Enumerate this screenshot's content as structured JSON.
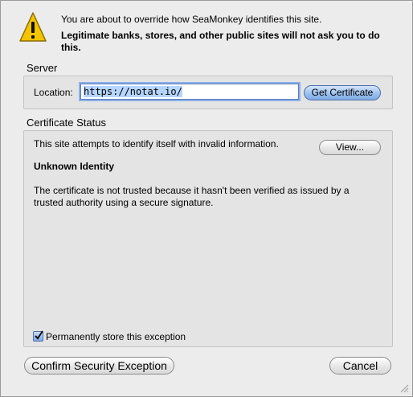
{
  "header": {
    "icon": "warning-icon",
    "message": "You are about to override how SeaMonkey identifies this site.",
    "warning": "Legitimate banks, stores, and other public sites will not ask you to do this."
  },
  "server": {
    "title": "Server",
    "location_label": "Location:",
    "location_value": "https://notat.io/",
    "get_certificate_label": "Get Certificate"
  },
  "certificate_status": {
    "title": "Certificate Status",
    "summary": "This site attempts to identify itself with invalid information.",
    "view_label": "View...",
    "identity_heading": "Unknown Identity",
    "detail": "The certificate is not trusted because it hasn't been verified as issued by a trusted authority using a secure signature."
  },
  "permanent_exception": {
    "label": "Permanently store this exception",
    "checked": true
  },
  "footer": {
    "confirm_label": "Confirm Security Exception",
    "cancel_label": "Cancel"
  },
  "colors": {
    "accent": "#7fabe6",
    "warning_yellow": "#f5c400"
  }
}
